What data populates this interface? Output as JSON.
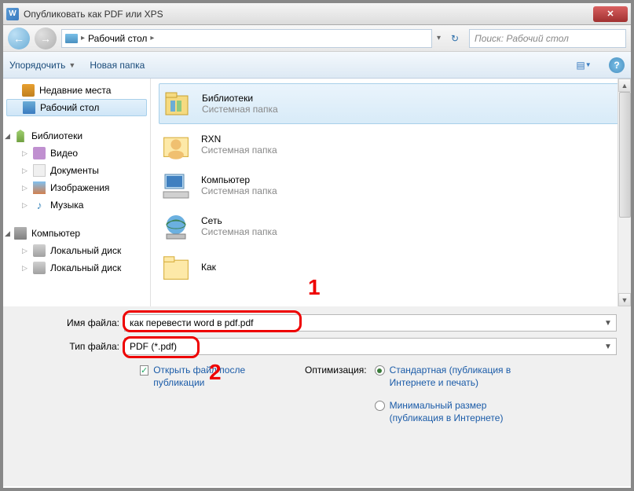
{
  "window": {
    "title": "Опубликовать как PDF или XPS"
  },
  "nav": {
    "breadcrumb": "Рабочий стол",
    "search_placeholder": "Поиск: Рабочий стол"
  },
  "toolbar": {
    "organize": "Упорядочить",
    "new_folder": "Новая папка"
  },
  "sidebar": {
    "recent": "Недавние места",
    "desktop": "Рабочий стол",
    "libraries": "Библиотеки",
    "video": "Видео",
    "documents": "Документы",
    "images": "Изображения",
    "music": "Музыка",
    "computer": "Компьютер",
    "localdisk1": "Локальный диск",
    "localdisk2": "Локальный диск"
  },
  "content": {
    "libraries": {
      "name": "Библиотеки",
      "sub": "Системная папка"
    },
    "rxn": {
      "name": "RXN",
      "sub": "Системная папка"
    },
    "computer": {
      "name": "Компьютер",
      "sub": "Системная папка"
    },
    "network": {
      "name": "Сеть",
      "sub": "Системная папка"
    },
    "kak": {
      "name": "Как"
    }
  },
  "markers": {
    "one": "1",
    "two": "2"
  },
  "fields": {
    "filename_label": "Имя файла:",
    "filename_value": "как перевести word в pdf.pdf",
    "filetype_label": "Тип файла:",
    "filetype_value": "PDF (*.pdf)"
  },
  "options": {
    "open_after": "Открыть файл после публикации",
    "optimize_label": "Оптимизация:",
    "standard": "Стандартная (публикация в Интернете и печать)",
    "minimal": "Минимальный размер (публикация в Интернете)"
  }
}
